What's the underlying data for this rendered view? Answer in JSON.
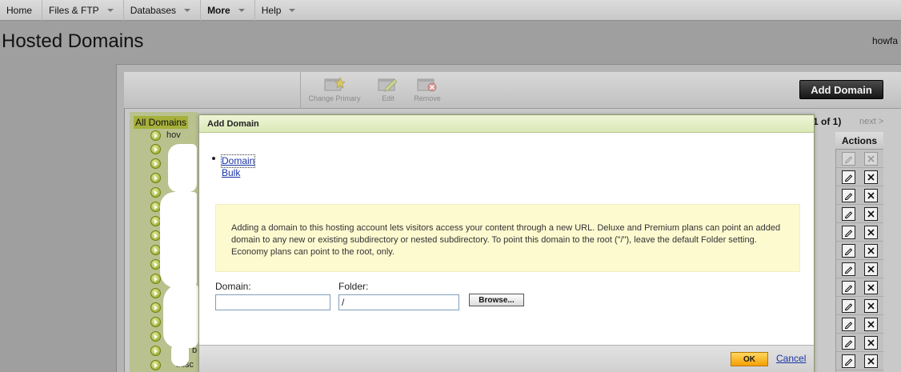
{
  "nav": [
    {
      "label": "Home",
      "caret": false,
      "bold": false
    },
    {
      "label": "Files & FTP",
      "caret": true,
      "bold": false
    },
    {
      "label": "Databases",
      "caret": true,
      "bold": false
    },
    {
      "label": "More",
      "caret": true,
      "bold": true
    },
    {
      "label": "Help",
      "caret": true,
      "bold": false
    }
  ],
  "page": {
    "title": "Hosted Domains",
    "user": "howfa"
  },
  "toolbar": {
    "change_primary": "Change Primary",
    "edit": "Edit",
    "remove": "Remove",
    "add_domain": "Add Domain"
  },
  "tree": {
    "all_label": "All Domains",
    "fragments": [
      "hov",
      "b",
      "inisc"
    ]
  },
  "pager": {
    "label": "1 of 1)",
    "next": "next >"
  },
  "actions": {
    "header": "Actions",
    "edit_icon": "pencil-icon",
    "delete_icon": "x-icon"
  },
  "modal": {
    "title": "Add Domain",
    "modes": [
      "Domain",
      "Bulk"
    ],
    "info": "Adding a domain to this hosting account lets visitors access your content through a new URL. Deluxe and Premium plans can point an added domain to any new or existing subdirectory or nested subdirectory. To point this domain to the root (\"/\"), leave the default Folder setting. Economy plans can point to the root, only.",
    "domain_label": "Domain:",
    "domain_value": "",
    "folder_label": "Folder:",
    "folder_value": "/",
    "browse_label": "Browse...",
    "ok_label": "OK",
    "cancel_label": "Cancel"
  },
  "colors": {
    "ok_button": "#f5a000",
    "link": "#1a35a8",
    "info_box": "#fdfad0",
    "tree_highlight": "#a6b03a"
  }
}
